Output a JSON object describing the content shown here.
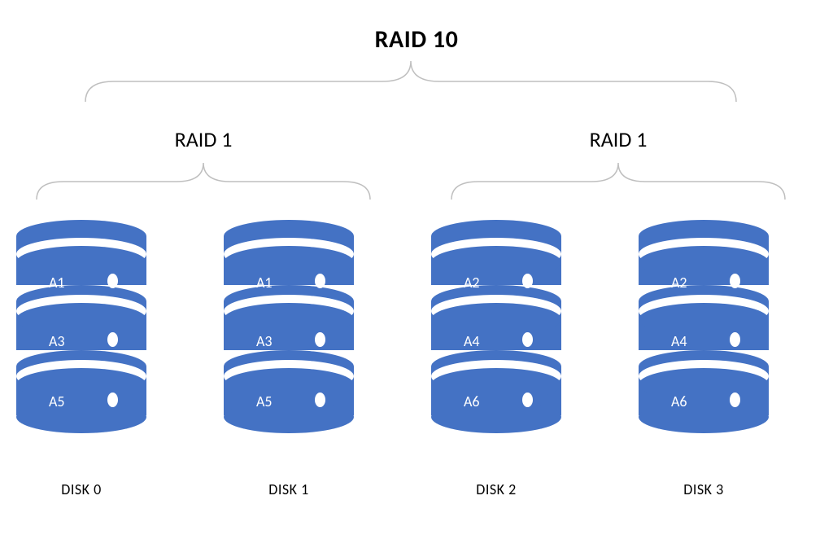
{
  "title": "RAID 10",
  "subgroups": [
    {
      "label": "RAID 1"
    },
    {
      "label": "RAID 1"
    }
  ],
  "disks": [
    {
      "name": "DISK 0",
      "segments": [
        "A1",
        "A3",
        "A5"
      ]
    },
    {
      "name": "DISK 1",
      "segments": [
        "A1",
        "A3",
        "A5"
      ]
    },
    {
      "name": "DISK 2",
      "segments": [
        "A2",
        "A4",
        "A6"
      ]
    },
    {
      "name": "DISK 3",
      "segments": [
        "A2",
        "A4",
        "A6"
      ]
    }
  ],
  "colors": {
    "disk_fill": "#4472C4",
    "bracket": "#BFBFBF",
    "text_light": "#FFFFFF",
    "text_dark": "#000000"
  }
}
